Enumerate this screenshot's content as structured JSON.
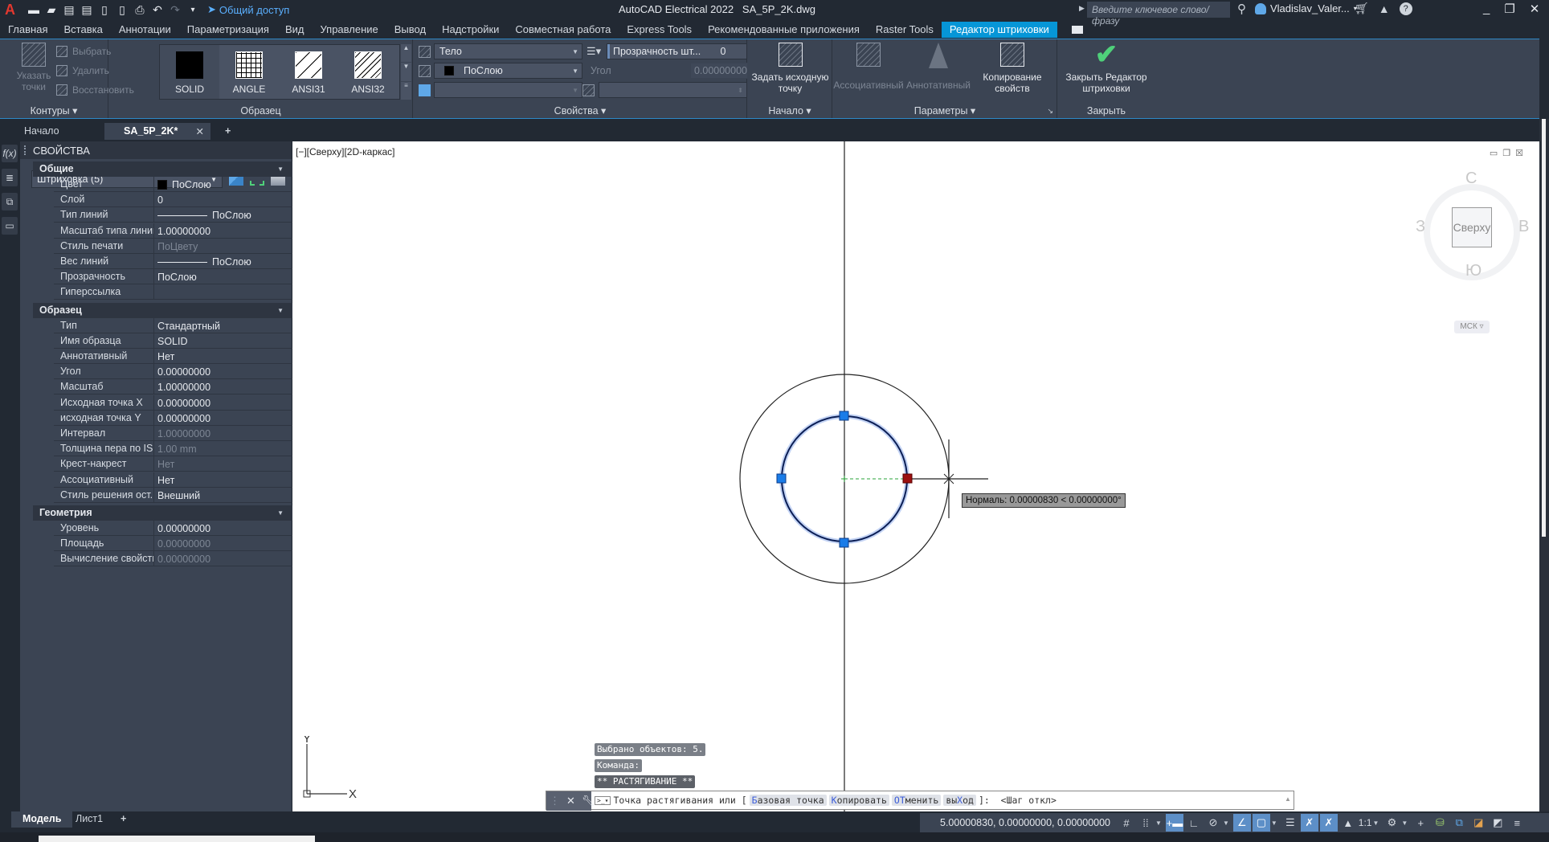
{
  "titlebar": {
    "app_title": "AutoCAD Electrical 2022",
    "file_name": "SA_5P_2K.dwg",
    "share_label": "Общий доступ",
    "search_placeholder": "Введите ключевое слово/фразу",
    "user_name": "Vladislav_Valer...",
    "qat_icons": [
      "new-icon",
      "open-icon",
      "save-icon",
      "save-as-icon",
      "open-from-web-icon",
      "save-to-web-icon",
      "print-icon",
      "undo-icon",
      "redo-icon",
      "customize-qat-icon"
    ]
  },
  "menu_tabs": [
    {
      "label": "Главная"
    },
    {
      "label": "Вставка"
    },
    {
      "label": "Аннотации"
    },
    {
      "label": "Параметризация"
    },
    {
      "label": "Вид"
    },
    {
      "label": "Управление"
    },
    {
      "label": "Вывод"
    },
    {
      "label": "Надстройки"
    },
    {
      "label": "Совместная работа"
    },
    {
      "label": "Express Tools"
    },
    {
      "label": "Рекомендованные приложения"
    },
    {
      "label": "Raster Tools"
    },
    {
      "label": "Редактор штриховки",
      "active": true
    }
  ],
  "ribbon": {
    "boundaries": {
      "title": "Контуры",
      "pick_points": "Указать точки",
      "select": "Выбрать",
      "remove": "Удалить",
      "recreate": "Восстановить"
    },
    "pattern": {
      "title": "Образец",
      "swatches": [
        {
          "name": "SOLID",
          "selected": true
        },
        {
          "name": "ANGLE"
        },
        {
          "name": "ANSI31"
        },
        {
          "name": "ANSI32"
        }
      ]
    },
    "properties": {
      "title": "Свойства",
      "hatch_type": "Тело",
      "hatch_color": "ПоСлою",
      "background_color": "",
      "transparency_label": "Прозрачность шт...",
      "transparency_value": "0",
      "angle_label": "Угол",
      "angle_value": "0.00000000",
      "scale_value": ""
    },
    "origin": {
      "title": "Начало",
      "set_origin": "Задать исходную точку"
    },
    "options": {
      "title": "Параметры",
      "associative": "Ассоциативный",
      "annotative": "Аннотативный",
      "match_properties": "Копирование свойств"
    },
    "close": {
      "title": "Закрыть",
      "close_editor": "Закрыть Редактор штриховки"
    }
  },
  "doc_tabs": [
    {
      "label": "Начало"
    },
    {
      "label": "SA_5P_2K*",
      "active": true
    }
  ],
  "properties_palette": {
    "title": "СВОЙСТВА",
    "selection": "Штриховка (5)",
    "categories": [
      {
        "name": "Общие",
        "rows": [
          {
            "key": "Цвет",
            "value": "ПоСлою",
            "swatch": true
          },
          {
            "key": "Слой",
            "value": "0"
          },
          {
            "key": "Тип линий",
            "value": "ПоСлою",
            "line": true
          },
          {
            "key": "Масштаб типа линий",
            "value": "1.00000000"
          },
          {
            "key": "Стиль печати",
            "value": "ПоЦвету",
            "disabled": true
          },
          {
            "key": "Вес линий",
            "value": "ПоСлою",
            "line": true
          },
          {
            "key": "Прозрачность",
            "value": "ПоСлою"
          },
          {
            "key": "Гиперссылка",
            "value": ""
          }
        ]
      },
      {
        "name": "Образец",
        "rows": [
          {
            "key": "Тип",
            "value": "Стандартный"
          },
          {
            "key": "Имя образца",
            "value": "SOLID"
          },
          {
            "key": "Аннотативный",
            "value": "Нет"
          },
          {
            "key": "Угол",
            "value": "0.00000000"
          },
          {
            "key": "Масштаб",
            "value": "1.00000000"
          },
          {
            "key": "Исходная точка X",
            "value": "0.00000000"
          },
          {
            "key": "исходная точка Y",
            "value": "0.00000000"
          },
          {
            "key": "Интервал",
            "value": "1.00000000",
            "disabled": true
          },
          {
            "key": "Толщина пера по ISO",
            "value": "1.00 mm",
            "disabled": true
          },
          {
            "key": "Крест-накрест",
            "value": "Нет",
            "disabled": true
          },
          {
            "key": "Ассоциативный",
            "value": "Нет"
          },
          {
            "key": "Стиль решения ост...",
            "value": "Внешний"
          }
        ]
      },
      {
        "name": "Геометрия",
        "rows": [
          {
            "key": "Уровень",
            "value": "0.00000000"
          },
          {
            "key": "Площадь",
            "value": "0.00000000",
            "disabled": true
          },
          {
            "key": "Вычисление свойств",
            "value": "0.00000000",
            "disabled": true
          }
        ]
      }
    ]
  },
  "viewport": {
    "view_label": "[−][Сверху][2D-каркас]",
    "viewcube": {
      "face": "Сверху",
      "north": "С",
      "south": "Ю",
      "west": "З",
      "east": "В",
      "ucs": "МСК"
    },
    "tooltip": "Нормаль: 0.00000830 < 0.00000000°",
    "ucs_x": "X",
    "ucs_y": "Y"
  },
  "command": {
    "history": [
      "Выбрано объектов: 5.",
      "Команда:",
      "** РАСТЯГИВАНИЕ **"
    ],
    "prompt_prefix": "Точка растягивания или [",
    "options": [
      {
        "hot": "Б",
        "rest": "азовая точка"
      },
      {
        "hot": "К",
        "rest": "опировать"
      },
      {
        "hot": "ОТ",
        "rest": "менить"
      },
      {
        "pre": "вы",
        "hot": "Х",
        "rest": "од"
      }
    ],
    "prompt_suffix": "]:  <Шаг откл>"
  },
  "layout_tabs": [
    {
      "label": "Модель",
      "active": true
    },
    {
      "label": "Лист1"
    }
  ],
  "statusbar": {
    "coords": "5.00000830, 0.00000000, 0.00000000",
    "annotation_scale": "1:1"
  }
}
